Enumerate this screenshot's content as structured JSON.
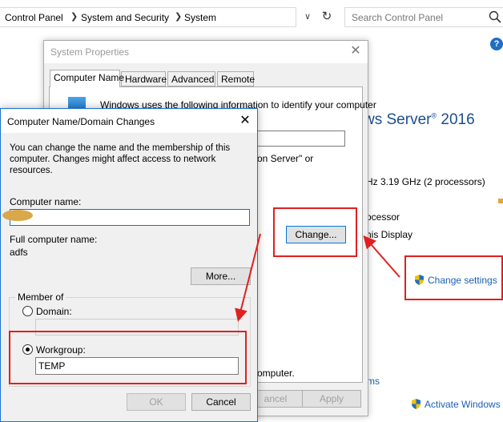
{
  "address_bar": {
    "breadcrumbs": [
      "Control Panel",
      "System and Security",
      "System"
    ],
    "search_placeholder": "Search Control Panel"
  },
  "background": {
    "windows_edition": "ws Server",
    "windows_edition_mark": "®",
    "windows_year": " 2016",
    "processor_speed": "Hz  3.19 GHz  (2 processors)",
    "processor_label": "ocessor",
    "display_label": "his Display",
    "change_settings_link": "Change settings",
    "ms_link": "ms",
    "activate_link": "Activate Windows"
  },
  "system_properties": {
    "title": "System Properties",
    "tabs": [
      "Computer Name",
      "Hardware",
      "Advanced",
      "Remote"
    ],
    "intro": "Windows uses the following information to identify your computer",
    "hint": "on Server\" or",
    "change_button": "Change...",
    "tail_text": "omputer.",
    "cancel_button": "ancel",
    "apply_button": "Apply"
  },
  "name_dialog": {
    "title": "Computer Name/Domain Changes",
    "intro": "You can change the name and the membership of this computer. Changes might affect access to network resources.",
    "computer_name_label": "Computer name:",
    "computer_name_value": "",
    "full_name_label": "Full computer name:",
    "full_name_value": "adfs",
    "more_button": "More...",
    "member_of_label": "Member of",
    "domain_label": "Domain:",
    "domain_value": "",
    "workgroup_label": "Workgroup:",
    "workgroup_value": "TEMP",
    "selected_membership": "Workgroup",
    "ok_button": "OK",
    "cancel_button": "Cancel"
  },
  "colors": {
    "annotation_red": "#e02020",
    "link_blue": "#1a5fb4",
    "focus_blue": "#0078d7"
  }
}
